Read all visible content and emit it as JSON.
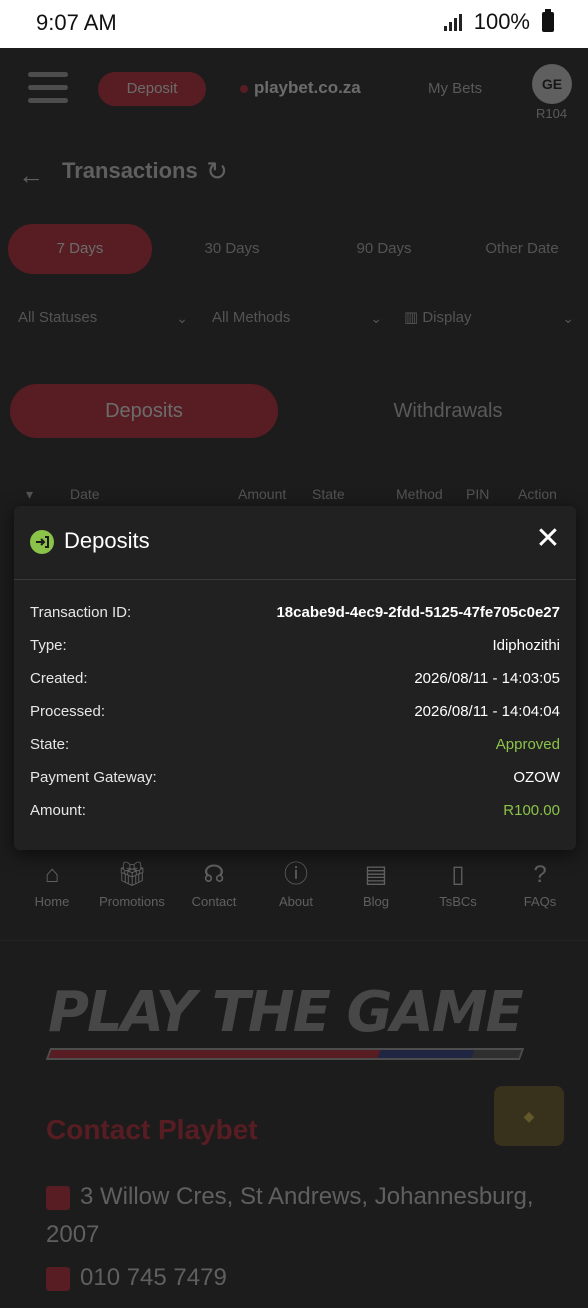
{
  "statusbar": {
    "time": "9:07 AM",
    "battery": "100%"
  },
  "topnav": {
    "deposit": "Deposit",
    "logo": "playbet.co.za",
    "my_bets": "My Bets",
    "avatar": "GE",
    "balance": "R104"
  },
  "page": {
    "title": "Transactions"
  },
  "days": [
    "7 Days",
    "30 Days",
    "90 Days",
    "Other Date"
  ],
  "filters": {
    "status": "All Statuses",
    "methods": "All Methods",
    "display": "Display"
  },
  "tabs": {
    "deposits": "Deposits",
    "withdrawals": "Withdrawals"
  },
  "table_head": [
    "Date",
    "Amount",
    "State",
    "Method",
    "PIN",
    "Action"
  ],
  "modal": {
    "title": "Deposits",
    "close": "✕",
    "rows": [
      {
        "label": "Transaction ID:",
        "value": "18cabe9d-4ec9-2fdd-5125-47fe705c0e27"
      },
      {
        "label": "Type:",
        "value": "Idiphozithi"
      },
      {
        "label": "Created:",
        "value": "2026/08/11 - 14:03:05"
      },
      {
        "label": "Processed:",
        "value": "2026/08/11 - 14:04:04"
      },
      {
        "label": "State:",
        "value": "Approved"
      },
      {
        "label": "Payment Gateway:",
        "value": "OZOW"
      },
      {
        "label": "Amount:",
        "value": "R100.00"
      }
    ],
    "accent": "#8bc34a"
  },
  "footer_nav": [
    "Home",
    "Promotions",
    "Contact",
    "About",
    "Blog",
    "TsBCs",
    "FAQs"
  ],
  "banner": {
    "text": "PLAY THE GAME"
  },
  "contact": {
    "title": "Contact Playbet",
    "address": "3 Willow Cres, St Andrews, Johannesburg, 2007",
    "phone": "010 745 7479"
  },
  "colors": {
    "brand_red": "#c8202e",
    "background": "#1c1c1c",
    "modal_bg": "#212121"
  }
}
